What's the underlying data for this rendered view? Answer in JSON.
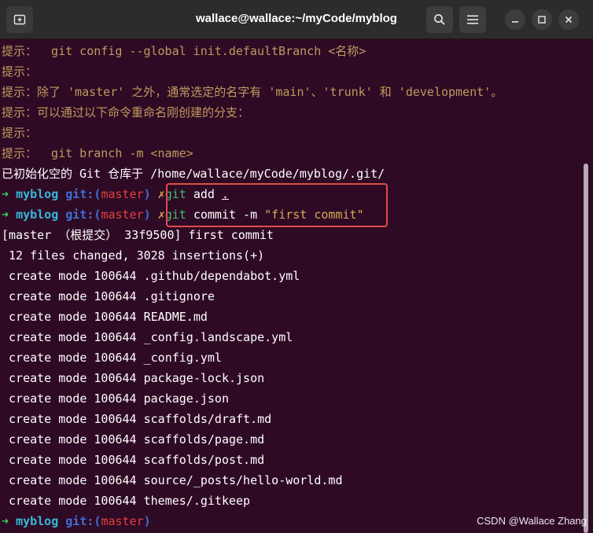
{
  "window": {
    "title": "wallace@wallace:~/myCode/myblog"
  },
  "icons": {
    "new_tab": "new-tab-icon",
    "search": "search-icon",
    "menu": "hamburger-menu-icon",
    "minimize": "minimize-icon",
    "maximize": "maximize-icon",
    "close": "close-icon"
  },
  "terminal": {
    "hints": [
      "提示：  git config --global init.defaultBranch <名称>",
      "提示：",
      "提示：除了 'master' 之外，通常选定的名字有 'main'、'trunk' 和 'development'。",
      "提示：可以通过以下命令重命名刚创建的分支：",
      "提示：",
      "提示：  git branch -m <name>"
    ],
    "init_msg": "已初始化空的 Git 仓库于 /home/wallace/myCode/myblog/.git/",
    "prompt": {
      "arrow": "➜",
      "dir": "myblog",
      "git": "git:(",
      "branch": "master",
      "close": ")",
      "cross": "✗"
    },
    "cmd1": {
      "git": "git",
      "rest": " add ",
      "dot": "."
    },
    "cmd2": {
      "git": "git",
      "rest": " commit -m ",
      "str": "\"first commit\""
    },
    "commit_header": "[master （根提交） 33f9500] first commit",
    "stats": " 12 files changed, 3028 insertions(+)",
    "created": [
      " create mode 100644 .github/dependabot.yml",
      " create mode 100644 .gitignore",
      " create mode 100644 README.md",
      " create mode 100644 _config.landscape.yml",
      " create mode 100644 _config.yml",
      " create mode 100644 package-lock.json",
      " create mode 100644 package.json",
      " create mode 100644 scaffolds/draft.md",
      " create mode 100644 scaffolds/page.md",
      " create mode 100644 scaffolds/post.md",
      " create mode 100644 source/_posts/hello-world.md",
      " create mode 100644 themes/.gitkeep"
    ]
  },
  "watermark": "CSDN @Wallace Zhang"
}
